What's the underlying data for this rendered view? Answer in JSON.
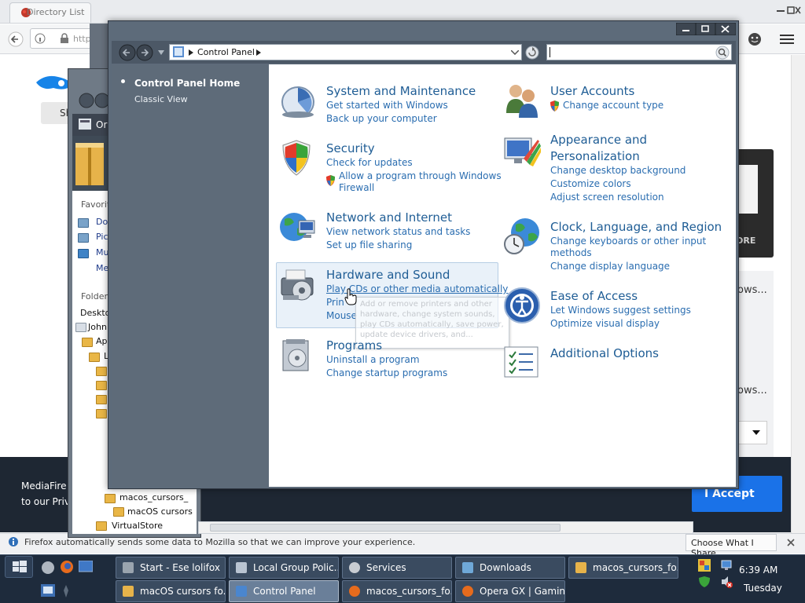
{
  "firefox": {
    "tab_title": "Directory List",
    "url_partial": "http",
    "share_label": "Sh",
    "dark_card_more": "ORE",
    "side_item_1": "ows...",
    "side_item_2": "ows...",
    "banner_line1": "MediaFire",
    "banner_line2": "to our Priv",
    "accept_label": "I Accept",
    "notification": "Firefox automatically sends some data to Mozilla so that we can improve your experience.",
    "notification_button": "Choose What I Share"
  },
  "explorer": {
    "header_label": "Or",
    "favorites_label": "Favorit",
    "fav_items": [
      "Do",
      "Pic",
      "Mu",
      "Me"
    ],
    "folders_label": "Folder",
    "tree_items": [
      "Deskto",
      "John",
      "Ap",
      "L",
      "macos_cursors_",
      "macOS cursors",
      "VirtualStore"
    ]
  },
  "control_panel": {
    "address_path": "Control Panel",
    "left_nav": {
      "home": "Control Panel Home",
      "classic": "Classic View"
    },
    "categories": [
      {
        "title": "System and Maintenance",
        "links": [
          "Get started with Windows",
          "Back up your computer"
        ]
      },
      {
        "title": "Security",
        "links": [
          "Check for updates",
          "Allow a program through Windows",
          "Firewall"
        ]
      },
      {
        "title": "Network and Internet",
        "links": [
          "View network status and tasks",
          "Set up file sharing"
        ]
      },
      {
        "title": "Hardware and Sound",
        "links": [
          "Play CDs or other media automatically",
          "Prin",
          "Mouse"
        ]
      },
      {
        "title": "Programs",
        "links": [
          "Uninstall a program",
          "Change startup programs"
        ]
      },
      {
        "title": "User Accounts",
        "links": [
          "Change account type"
        ]
      },
      {
        "title": "Appearance and",
        "title2": "Personalization",
        "links": [
          "Change desktop background",
          "Customize colors",
          "Adjust screen resolution"
        ]
      },
      {
        "title": "Clock, Language, and Region",
        "links": [
          "Change keyboards or other input",
          "methods",
          "Change display language"
        ]
      },
      {
        "title": "Ease of Access",
        "links": [
          "Let Windows suggest settings",
          "Optimize visual display"
        ]
      },
      {
        "title": "Additional Options",
        "links": []
      }
    ],
    "tooltip": "Add or remove printers and other hardware, change system sounds, play CDs automatically, save power, update device drivers, and..."
  },
  "taskbar": {
    "buttons_row1": [
      "Start - Ese lolifox",
      "Local Group Polic...",
      "Services",
      "Downloads",
      "macos_cursors_fo..."
    ],
    "buttons_row2": [
      "macOS cursors fo...",
      "Control Panel",
      "macos_cursors_fo...",
      "Opera GX | Gamin..."
    ],
    "clock_time": "6:39 AM",
    "clock_day": "Tuesday"
  }
}
